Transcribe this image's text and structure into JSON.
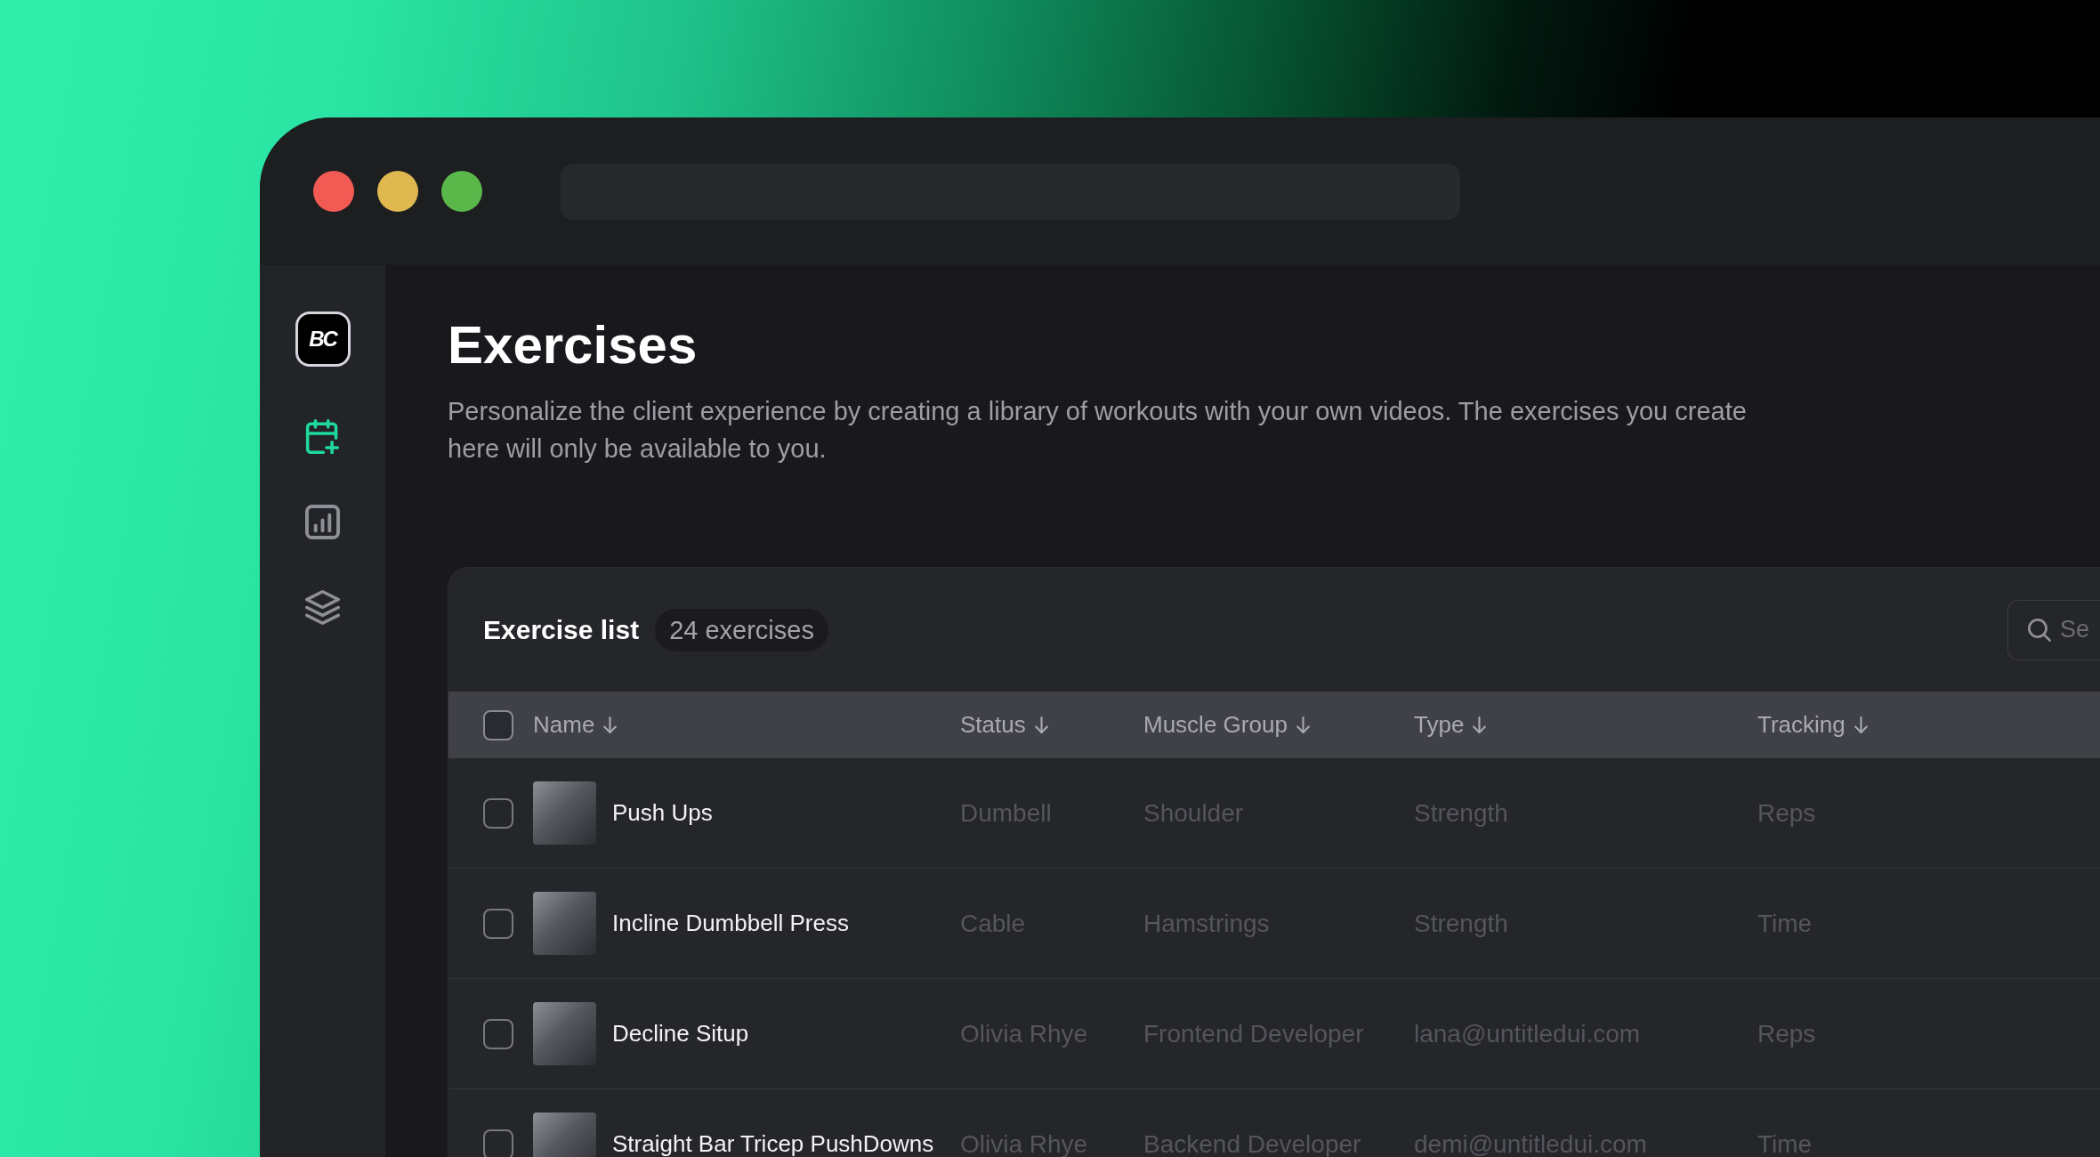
{
  "sidebar": {
    "logo_text": "BC",
    "items": [
      {
        "selected": true
      },
      {
        "selected": false
      },
      {
        "selected": false
      }
    ]
  },
  "page": {
    "title": "Exercises",
    "description": "Personalize the client experience by creating a library of workouts with your own videos. The exercises you create here will only be available to you."
  },
  "exercise_list": {
    "title": "Exercise list",
    "count": "24 exercises",
    "search": {
      "placeholder": "Se"
    },
    "select_all": {
      "checked": false
    },
    "columns": [
      {
        "label": "Name",
        "sortable": true
      },
      {
        "label": "Status",
        "sortable": true
      },
      {
        "label": "Muscle Group",
        "sortable": true
      },
      {
        "label": "Type",
        "sortable": true
      },
      {
        "label": "Tracking",
        "sortable": true
      }
    ],
    "rows": [
      {
        "checked": false,
        "cells": [
          "Push Ups",
          "Dumbell",
          "Shoulder",
          "Strength",
          "Reps"
        ]
      },
      {
        "checked": false,
        "cells": [
          "Incline Dumbbell Press",
          "Cable",
          "Hamstrings",
          "Strength",
          "Time"
        ]
      },
      {
        "checked": false,
        "cells": [
          "Decline Situp",
          "Olivia Rhye",
          "Frontend Developer",
          "lana@untitledui.com",
          "Reps"
        ]
      },
      {
        "checked": false,
        "cells": [
          "Straight Bar Tricep PushDowns",
          "Olivia Rhye",
          "Backend Developer",
          "demi@untitledui.com",
          "Time"
        ]
      }
    ]
  }
}
